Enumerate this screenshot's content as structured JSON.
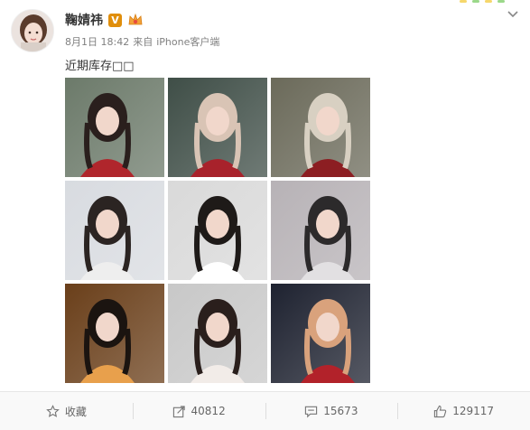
{
  "post": {
    "username": "鞠婧祎",
    "verified_badge": "V",
    "timestamp": "8月1日 18:42",
    "source_prefix": "来自",
    "source_client": "iPhone客户端",
    "text": "近期库存□□"
  },
  "photos": [
    {
      "alt": "photo-1",
      "palette": [
        "#6c7a6a",
        "#b0262c",
        "#2a1f1d"
      ]
    },
    {
      "alt": "photo-2",
      "palette": [
        "#3f4e47",
        "#a8222b",
        "#d9c4b5"
      ]
    },
    {
      "alt": "photo-3",
      "palette": [
        "#6b6a5a",
        "#8c1e22",
        "#d8d0c2"
      ]
    },
    {
      "alt": "photo-4",
      "palette": [
        "#d8dbe0",
        "#eeeeee",
        "#2b2422"
      ]
    },
    {
      "alt": "photo-5",
      "palette": [
        "#d9d9d9",
        "#ffffff",
        "#1e1a18"
      ]
    },
    {
      "alt": "photo-6",
      "palette": [
        "#b7b2b6",
        "#e2e0e2",
        "#2c2a2b"
      ]
    },
    {
      "alt": "photo-7",
      "palette": [
        "#6a3f1a",
        "#e8a04c",
        "#1b1410"
      ]
    },
    {
      "alt": "photo-8",
      "palette": [
        "#c8c8c8",
        "#f2ece8",
        "#2a1f1c"
      ]
    },
    {
      "alt": "photo-9",
      "palette": [
        "#1e2230",
        "#b2222a",
        "#d9a27c"
      ]
    }
  ],
  "actions": {
    "favorite_label": "收藏",
    "repost_count": "40812",
    "comment_count": "15673",
    "like_count": "129117"
  },
  "icons": {
    "favorite": "star-icon",
    "repost": "share-icon",
    "comment": "comment-icon",
    "like": "thumbs-up-icon"
  },
  "colors": {
    "badge": "#e08e0b",
    "text": "#333333",
    "meta": "#808080"
  }
}
